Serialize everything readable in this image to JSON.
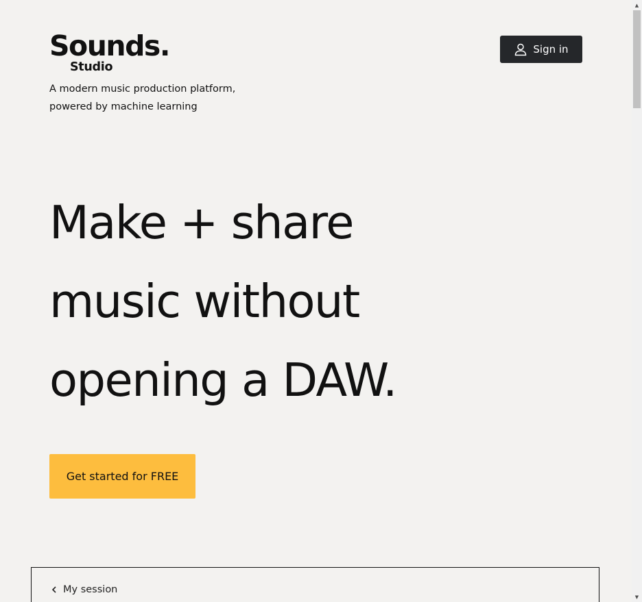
{
  "header": {
    "logo_word": "Sounds.",
    "logo_sub": "Studio",
    "tagline_line1": "A modern music production platform,",
    "tagline_line2": "powered by machine learning",
    "signin_label": "Sign in",
    "signin_icon": "user-icon"
  },
  "hero": {
    "line1": "Make + share",
    "line2": "music without",
    "line3": "opening a DAW.",
    "cta_label": "Get started for FREE"
  },
  "session": {
    "back_label": "My session",
    "back_icon": "chevron-left-icon"
  },
  "colors": {
    "background": "#f3f2f0",
    "signin_bg": "#25272a",
    "cta_bg": "#fdbd3e",
    "text": "#111111"
  }
}
